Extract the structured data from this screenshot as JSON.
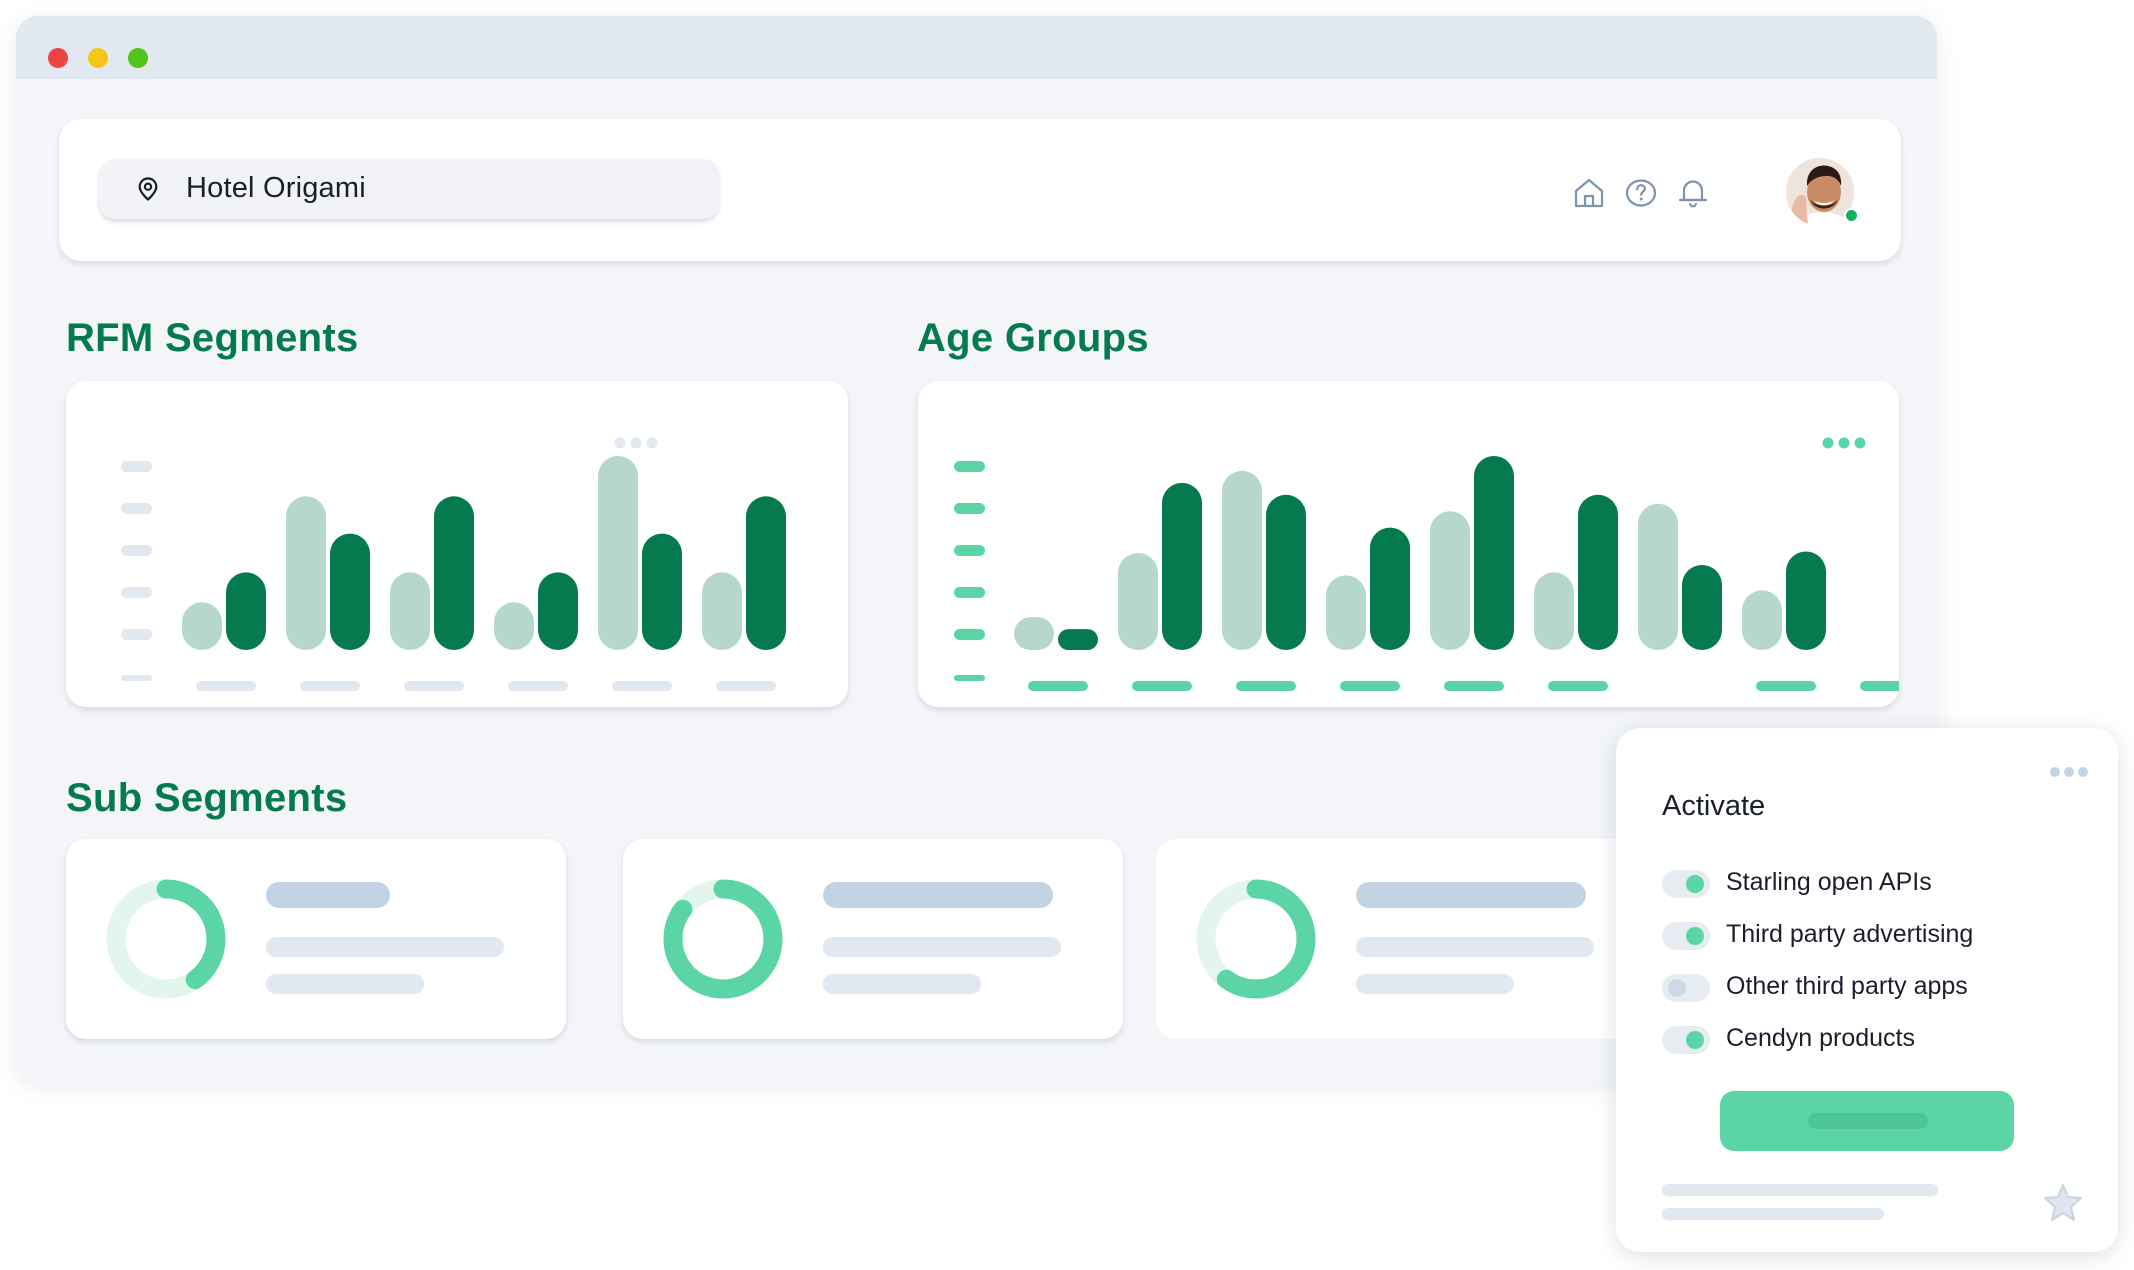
{
  "window": {
    "traffic_lights": {
      "close": "#ef4444",
      "minimize": "#f5c518",
      "maximize": "#52c41a"
    }
  },
  "header": {
    "location_icon": "map-pin-icon",
    "location_name": "Hotel Origami",
    "icons": [
      "home-icon",
      "help-icon",
      "bell-icon"
    ],
    "avatar_status": "online"
  },
  "colors": {
    "brand_green": "#067a4f",
    "light_green": "#b5d8ca",
    "mint": "#5bd5a5",
    "placeholder": "#e2e8f0",
    "placeholder_blue": "#c2d4e4"
  },
  "sections": {
    "rfm": "RFM Segments",
    "age": "Age Groups",
    "sub": "Sub Segments"
  },
  "chart_data": [
    {
      "type": "bar",
      "title": "RFM Segments",
      "ylim": [
        0,
        130
      ],
      "categories": [
        "",
        "",
        "",
        "",
        "",
        ""
      ],
      "series": [
        {
          "values": [
            32,
            103,
            52,
            32,
            130,
            52
          ]
        },
        {
          "values": [
            52,
            78,
            103,
            52,
            78,
            103
          ]
        }
      ],
      "legend": "none",
      "grid": false
    },
    {
      "type": "bar",
      "title": "Age Groups",
      "ylim": [
        0,
        130
      ],
      "categories": [
        "",
        "",
        "",
        "",
        "",
        "",
        "",
        "",
        ""
      ],
      "series": [
        {
          "values": [
            22,
            65,
            120,
            50,
            93,
            52,
            98,
            40,
            0
          ]
        },
        {
          "values": [
            14,
            112,
            104,
            82,
            130,
            104,
            57,
            66,
            0
          ]
        }
      ],
      "legend": "none",
      "grid": false
    }
  ],
  "sub_segments": [
    {
      "progress": 0.4
    },
    {
      "progress": 0.85
    },
    {
      "progress": 0.6
    }
  ],
  "activate": {
    "title": "Activate",
    "options": [
      {
        "label": "Starling open APIs",
        "enabled": true
      },
      {
        "label": "Third party advertising",
        "enabled": true
      },
      {
        "label": "Other third party apps",
        "enabled": false
      },
      {
        "label": "Cendyn products",
        "enabled": true
      }
    ],
    "bottom_icon": "star-icon"
  }
}
